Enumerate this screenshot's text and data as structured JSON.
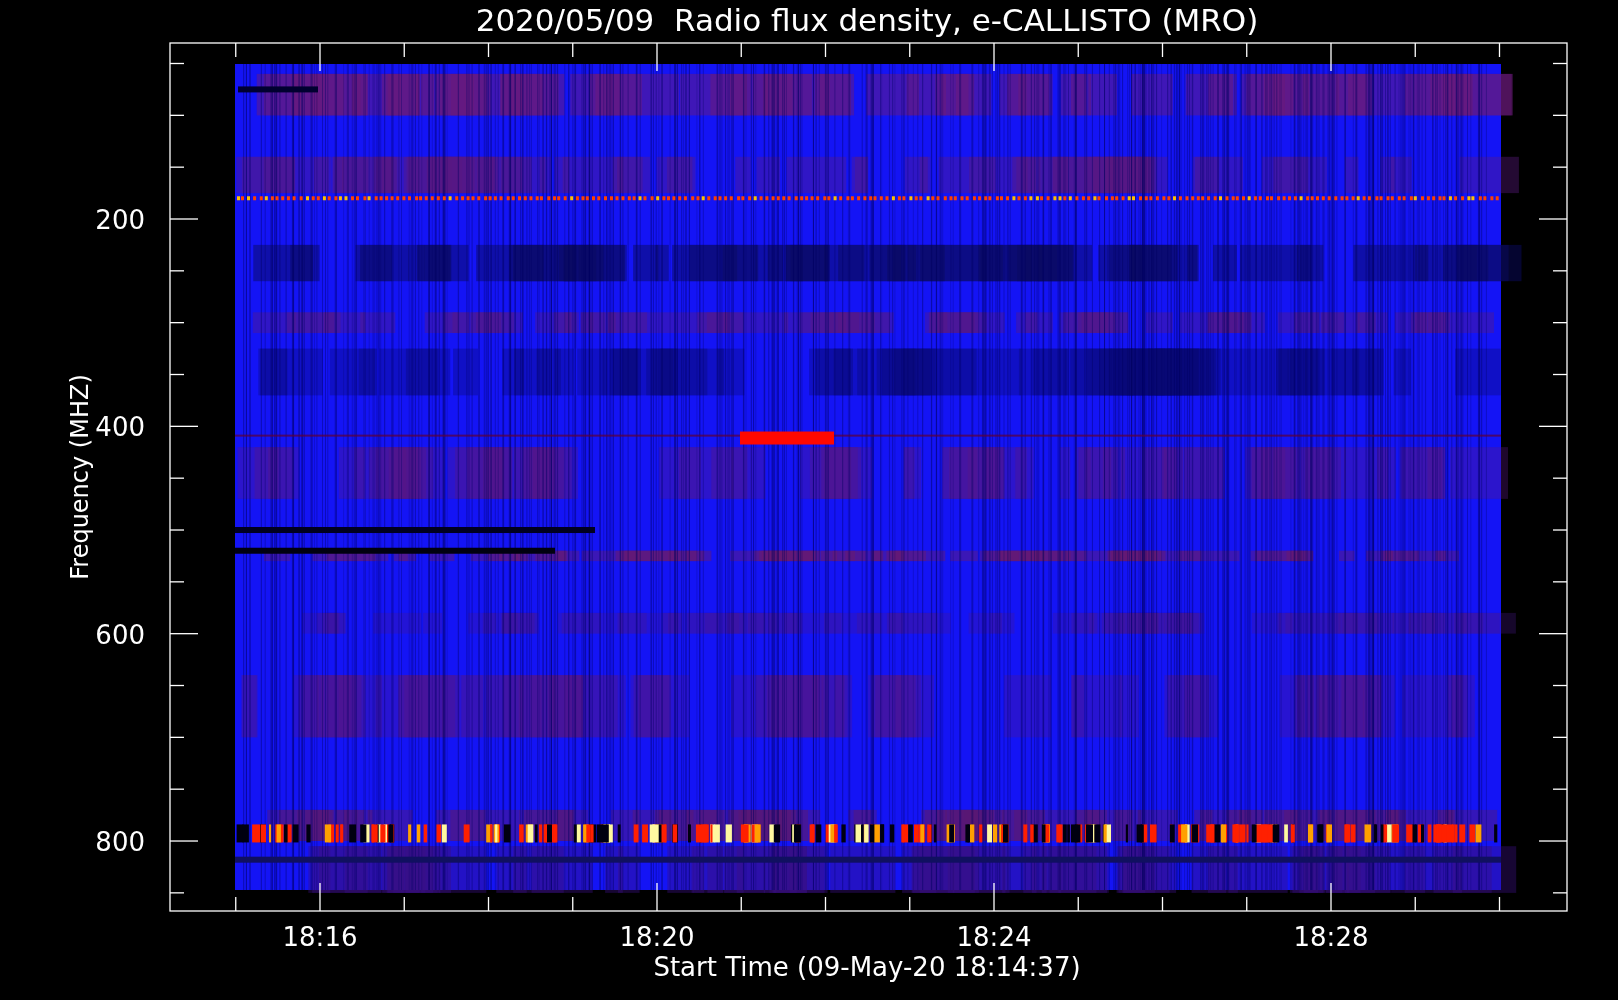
{
  "plot": {
    "title": "2020/05/09  Radio flux density, e-CALLISTO (MRO)",
    "ylabel": "Frequency (MHZ)",
    "xlabel": "Start Time (09-May-20 18:14:37)",
    "y_tick_labels": [
      "200",
      "400",
      "600",
      "800"
    ],
    "x_tick_labels": [
      "18:16",
      "18:20",
      "18:24",
      "18:28"
    ]
  }
}
